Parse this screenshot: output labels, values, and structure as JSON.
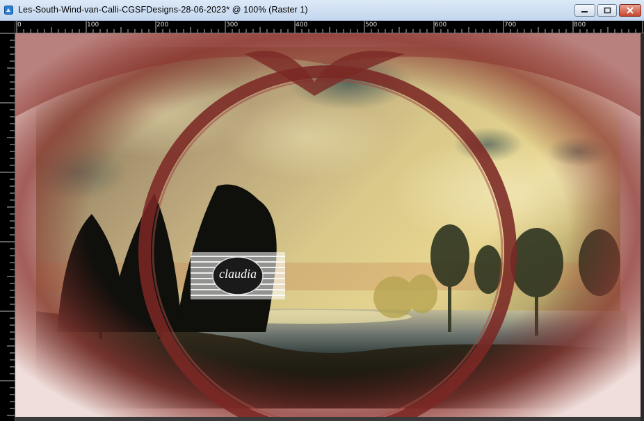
{
  "window": {
    "title": "Les-South-Wind-van-Calli-CGSFDesigns-28-06-2023* @ 100% (Raster 1)",
    "buttons": {
      "minimize": "minimize",
      "maximize": "maximize",
      "close": "close"
    }
  },
  "ruler": {
    "top_labels": [
      "0",
      "100",
      "200",
      "300",
      "400",
      "500",
      "600",
      "700",
      "800"
    ]
  },
  "canvas": {
    "logo_text": "claudia",
    "colors": {
      "frame_red": "#7d2a26",
      "pink_edge": "#e6c8c4",
      "sky_gold": "#d8c27a",
      "water": "#b8b49a"
    }
  }
}
